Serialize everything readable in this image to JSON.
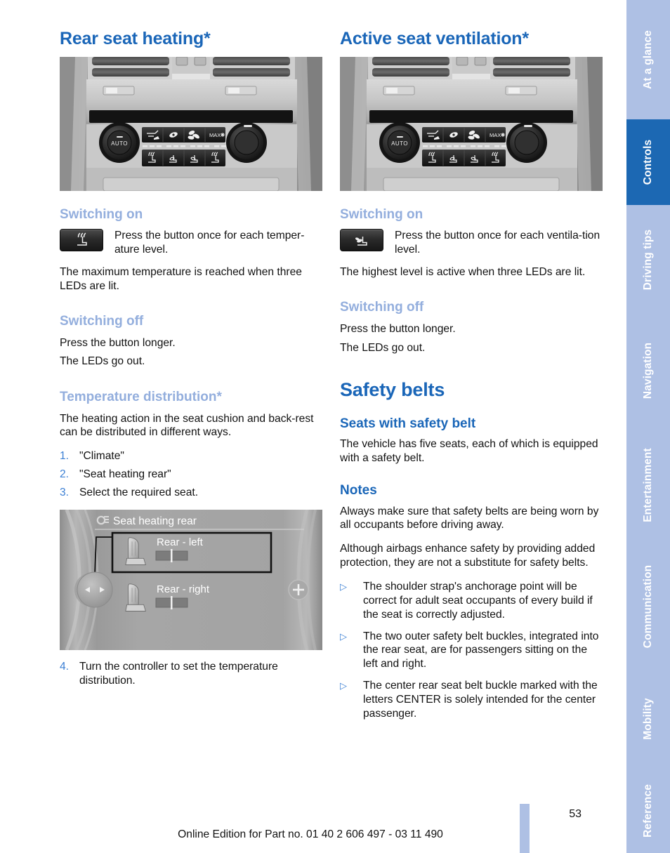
{
  "page": {
    "number": "53",
    "footer_text": "Online Edition for Part no. 01 40 2 606 497 - 03 11 490"
  },
  "tabs": [
    {
      "label": "At a glance",
      "active": false
    },
    {
      "label": "Controls",
      "active": true
    },
    {
      "label": "Driving tips",
      "active": false
    },
    {
      "label": "Navigation",
      "active": false
    },
    {
      "label": "Entertainment",
      "active": false
    },
    {
      "label": "Communication",
      "active": false
    },
    {
      "label": "Mobility",
      "active": false
    },
    {
      "label": "Reference",
      "active": false
    }
  ],
  "colors": {
    "heading_blue": "#1a66b8",
    "light_blue": "#93aedd",
    "tab_inactive": "#aec0e4",
    "tab_active": "#1c68b3",
    "marker_blue": "#3b7fd4"
  },
  "left_column": {
    "title": "Rear seat heating*",
    "figure_caption": "rear climate control panel with seat heating buttons",
    "switching_on": {
      "heading": "Switching on",
      "icon_name": "seat-heating-button-icon",
      "icon_text": "Press the button once for each temper-ature level.",
      "body": "The maximum temperature is reached when three LEDs are lit."
    },
    "switching_off": {
      "heading": "Switching off",
      "line1": "Press the button longer.",
      "line2": "The LEDs go out."
    },
    "temperature_distribution": {
      "heading": "Temperature distribution*",
      "intro": "The heating action in the seat cushion and back-rest can be distributed in different ways.",
      "steps": [
        {
          "num": "1.",
          "text": "\"Climate\""
        },
        {
          "num": "2.",
          "text": "\"Seat heating rear\""
        },
        {
          "num": "3.",
          "text": "Select the required seat."
        },
        {
          "num": "4.",
          "text": "Turn the controller to set the temperature distribution."
        }
      ]
    },
    "idrive": {
      "menu_title": "Seat heating rear",
      "gear_icon": "settings-gear-icon",
      "items": [
        {
          "label": "Rear - left",
          "selected": true
        },
        {
          "label": "Rear - right",
          "selected": false
        }
      ],
      "plus_button": "+",
      "arrow_left": "◀",
      "arrow_right": "▶"
    }
  },
  "right_column": {
    "title": "Active seat ventilation*",
    "figure_caption": "rear climate control panel with seat ventilation buttons",
    "switching_on": {
      "heading": "Switching on",
      "icon_name": "seat-ventilation-button-icon",
      "icon_text": "Press the button once for each ventila-tion level.",
      "body": "The highest level is active when three LEDs are lit."
    },
    "switching_off": {
      "heading": "Switching off",
      "line1": "Press the button longer.",
      "line2": "The LEDs go out."
    },
    "safety_belts": {
      "title": "Safety belts",
      "seats_heading": "Seats with safety belt",
      "seats_body": "The vehicle has five seats, each of which is equipped with a safety belt.",
      "notes_heading": "Notes",
      "note1": "Always make sure that safety belts are being worn by all occupants before driving away.",
      "note2": "Although airbags enhance safety by providing added protection, they are not a substitute for safety belts.",
      "bullets": [
        "The shoulder strap's anchorage point will be correct for adult seat occupants of every build if the seat is correctly adjusted.",
        "The two outer safety belt buckles, integrated into the rear seat, are for passengers sitting on the left and right.",
        "The center rear seat belt buckle marked with the letters CENTER is solely intended for the center passenger."
      ]
    }
  },
  "climate_panel": {
    "auto_label": "AUTO",
    "max_label": "MAX",
    "top_buttons": [
      "airflow-seat-icon",
      "recirculation-icon",
      "fan-icon",
      "max-ac-icon"
    ],
    "bottom_buttons": [
      "seat-heating-left-icon",
      "seat-ventilation-left-icon",
      "seat-ventilation-right-icon",
      "seat-heating-right-icon"
    ]
  }
}
